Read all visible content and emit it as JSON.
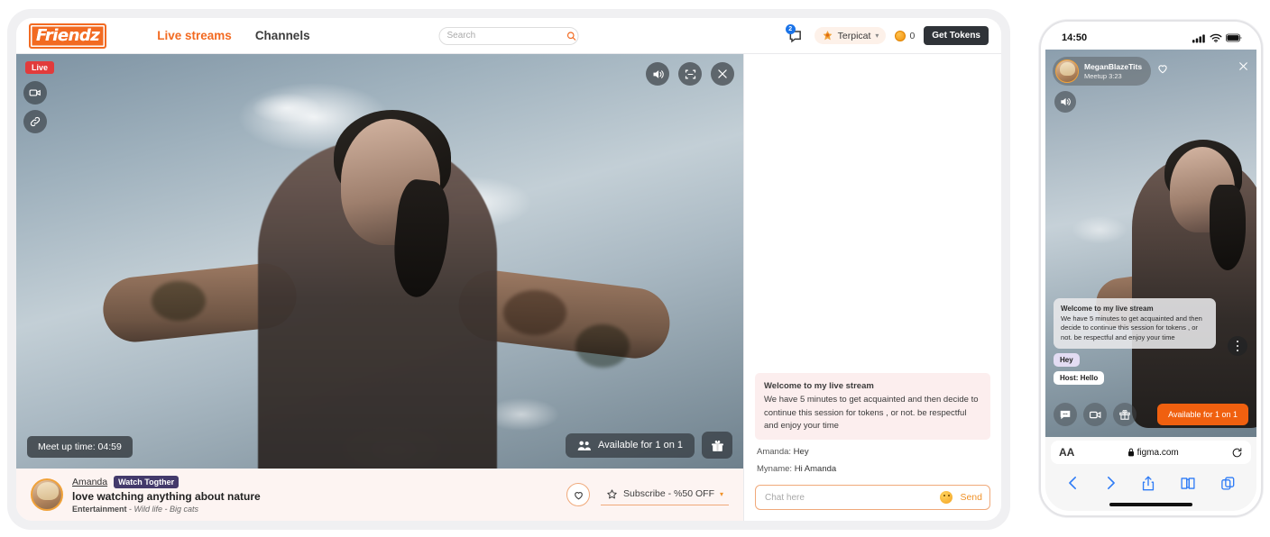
{
  "desktop": {
    "header": {
      "logo": "Friendz",
      "nav": [
        {
          "label": "Live streams",
          "active": true
        },
        {
          "label": "Channels",
          "active": false
        }
      ],
      "search": {
        "placeholder": "Search",
        "value": "",
        "icon": "search-icon"
      },
      "messages": {
        "icon": "message-icon",
        "badge": "2"
      },
      "user": {
        "name": "Terpicat",
        "icon": "crown-icon",
        "chevron": "chevron-down-icon"
      },
      "tokens": {
        "icon": "coin-icon",
        "count": "0"
      },
      "get_tokens_label": "Get Tokens"
    },
    "video": {
      "live_badge": "Live",
      "left_buttons": [
        {
          "name": "camera-icon"
        },
        {
          "name": "link-icon"
        }
      ],
      "top_right_buttons": [
        {
          "name": "volume-icon"
        },
        {
          "name": "fullscreen-icon"
        },
        {
          "name": "close-icon"
        }
      ],
      "meetup_timer": "Meet up time: 04:59",
      "available_label": "Available for 1 on 1",
      "available_icon": "people-icon",
      "gift_icon": "gift-icon"
    },
    "info_bar": {
      "streamer_name": "Amanda",
      "watch_badge": "Watch Togther",
      "title": "love watching anything about nature",
      "category": "Entertainment",
      "tags": "Wild life - Big cats",
      "heart_icon": "heart-icon",
      "subscribe": {
        "label": "Subscribe - %50 OFF",
        "icon": "star-icon",
        "chevron": "chevron-down-icon"
      }
    },
    "chat": {
      "system_message": {
        "title": "Welcome to my live stream",
        "body": "We have 5 minutes to get acquainted and then decide to continue this session for tokens , or not. be respectful and enjoy your time"
      },
      "messages": [
        {
          "author": "Amanda:",
          "text": "Hey"
        },
        {
          "author": "Myname:",
          "text": "Hi Amanda"
        }
      ],
      "input": {
        "placeholder": "Chat here",
        "value": ""
      },
      "emoji_icon": "emoji-icon",
      "send_label": "Send"
    }
  },
  "phone": {
    "status_bar": {
      "time": "14:50",
      "icons": [
        "cellular-icon",
        "wifi-icon",
        "battery-icon"
      ]
    },
    "top": {
      "user_name": "MeganBlazeTits",
      "user_sub": "Meetup 3:23",
      "heart_icon": "heart-icon",
      "close_icon": "close-icon",
      "speaker_icon": "volume-icon",
      "more_icon": "more-vertical-icon"
    },
    "chat": {
      "system_message": {
        "title": "Welcome to my live stream",
        "body": "We have 5 minutes to get acquainted and then decide to continue this session for tokens , or not. be respectful and enjoy your time"
      },
      "pills": [
        {
          "text": "Hey",
          "style": "purple"
        },
        {
          "text": "Host: Hello",
          "style": "white"
        }
      ]
    },
    "actions": {
      "buttons": [
        {
          "name": "chat-bubble-icon"
        },
        {
          "name": "video-camera-icon"
        },
        {
          "name": "gift-icon"
        }
      ],
      "available_label": "Available for 1 on 1"
    },
    "browser": {
      "text_size_label": "AA",
      "url": "figma.com",
      "lock_icon": "lock-icon",
      "reload_icon": "reload-icon",
      "nav_icons": [
        "back-icon",
        "forward-icon",
        "share-icon",
        "bookmarks-icon",
        "tabs-icon"
      ]
    }
  },
  "colors": {
    "accent_orange": "#f26a21",
    "mobile_cta": "#f0600f",
    "live_red": "#e23b3b",
    "dark_button": "#2f3338",
    "badge_purple": "#433a6b",
    "safari_blue": "#2f7cf6"
  }
}
